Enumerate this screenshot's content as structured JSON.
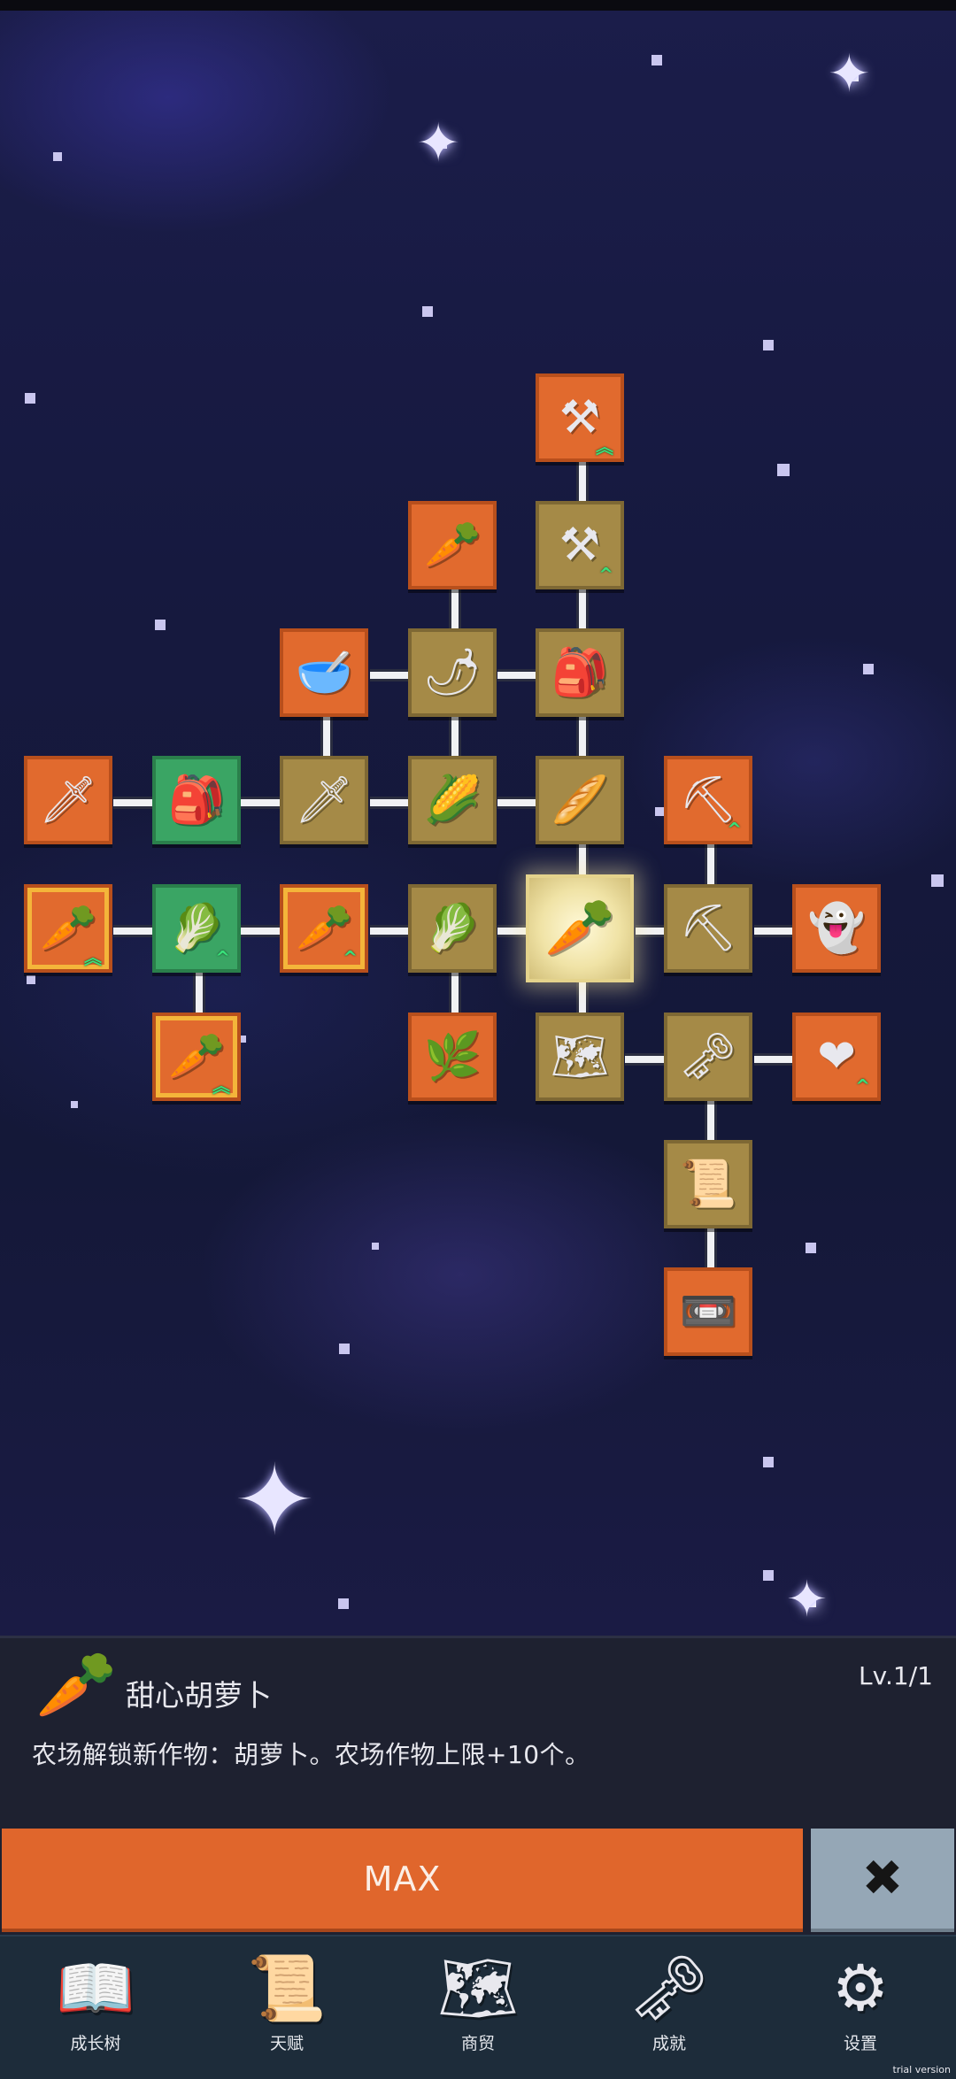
{
  "skill_tree": {
    "nodes": [
      {
        "id": "shovel-upgrade-2",
        "icon": "shovel-icon",
        "glyph": "⚒",
        "variant": "orange",
        "upgrade": "︽"
      },
      {
        "id": "radish",
        "icon": "radish-icon",
        "glyph": "🥕",
        "variant": "orange",
        "upgrade": ""
      },
      {
        "id": "shovel-upgrade-1",
        "icon": "shovel-icon",
        "glyph": "⚒",
        "variant": "gold",
        "upgrade": "^"
      },
      {
        "id": "bowl",
        "icon": "bowl-icon",
        "glyph": "🥣",
        "variant": "orange",
        "upgrade": ""
      },
      {
        "id": "chili",
        "icon": "chili-icon",
        "glyph": "🌶",
        "variant": "gold",
        "upgrade": ""
      },
      {
        "id": "sack",
        "icon": "sack-icon",
        "glyph": "🎒",
        "variant": "gold",
        "upgrade": ""
      },
      {
        "id": "sword-upgrade",
        "icon": "sword-icon",
        "glyph": "🗡",
        "variant": "orange",
        "upgrade": ""
      },
      {
        "id": "backpack",
        "icon": "backpack-icon",
        "glyph": "🎒",
        "variant": "green",
        "upgrade": ""
      },
      {
        "id": "sword",
        "icon": "sword-icon",
        "glyph": "🗡",
        "variant": "gold",
        "upgrade": ""
      },
      {
        "id": "corn",
        "icon": "corn-icon",
        "glyph": "🌽",
        "variant": "gold",
        "upgrade": ""
      },
      {
        "id": "stick",
        "icon": "stick-icon",
        "glyph": "🥖",
        "variant": "gold",
        "upgrade": ""
      },
      {
        "id": "pickaxe-upgrade",
        "icon": "pickaxe-icon",
        "glyph": "⛏",
        "variant": "orange",
        "upgrade": "^"
      },
      {
        "id": "carrot-upgrade-2",
        "icon": "carrot-icon",
        "glyph": "🥕",
        "variant": "orange",
        "upgrade": "︽"
      },
      {
        "id": "cabbage-upgrade",
        "icon": "cabbage-icon",
        "glyph": "🥬",
        "variant": "green",
        "upgrade": "^"
      },
      {
        "id": "carrot-upgrade-1",
        "icon": "carrot-icon",
        "glyph": "🥕",
        "variant": "orange",
        "upgrade": "^"
      },
      {
        "id": "cabbage",
        "icon": "cabbage-icon",
        "glyph": "🥬",
        "variant": "gold",
        "upgrade": ""
      },
      {
        "id": "sweet-carrot",
        "icon": "carrot-icon",
        "glyph": "🥕",
        "variant": "selected",
        "upgrade": ""
      },
      {
        "id": "pickaxe",
        "icon": "pickaxe-icon",
        "glyph": "⛏",
        "variant": "gold",
        "upgrade": ""
      },
      {
        "id": "ghost",
        "icon": "ghost-icon",
        "glyph": "👻",
        "variant": "orange",
        "upgrade": ""
      },
      {
        "id": "carrot-upgrade-3",
        "icon": "carrot-icon",
        "glyph": "🥕",
        "variant": "orange",
        "upgrade": "︽"
      },
      {
        "id": "root",
        "icon": "root-icon",
        "glyph": "🌿",
        "variant": "orange",
        "upgrade": ""
      },
      {
        "id": "map",
        "icon": "map-icon",
        "glyph": "🗺",
        "variant": "gold",
        "upgrade": ""
      },
      {
        "id": "key",
        "icon": "key-icon",
        "glyph": "🗝",
        "variant": "gold",
        "upgrade": ""
      },
      {
        "id": "heart",
        "icon": "heart-icon",
        "glyph": "❤",
        "variant": "orange",
        "upgrade": "^"
      },
      {
        "id": "scroll",
        "icon": "scroll-icon",
        "glyph": "📜",
        "variant": "gold",
        "upgrade": ""
      },
      {
        "id": "cassette",
        "icon": "cassette-icon",
        "glyph": "📼",
        "variant": "orange",
        "upgrade": ""
      }
    ]
  },
  "selected_skill": {
    "icon": "carrot-icon",
    "glyph": "🥕",
    "name": "甜心胡萝卜",
    "level": "Lv.1/1",
    "description": "农场解锁新作物：胡萝卜。农场作物上限+10个。"
  },
  "actions": {
    "max_label": "MAX",
    "close_glyph": "✖"
  },
  "nav": {
    "items": [
      {
        "label": "成长树",
        "icon": "book-icon",
        "glyph": "📖"
      },
      {
        "label": "天赋",
        "icon": "scroll-icon",
        "glyph": "📜"
      },
      {
        "label": "商贸",
        "icon": "map-icon",
        "glyph": "🗺"
      },
      {
        "label": "成就",
        "icon": "key-icon",
        "glyph": "🗝"
      },
      {
        "label": "设置",
        "icon": "gear-icon",
        "glyph": "⚙"
      }
    ]
  },
  "footer": {
    "trial_text": "trial version"
  }
}
